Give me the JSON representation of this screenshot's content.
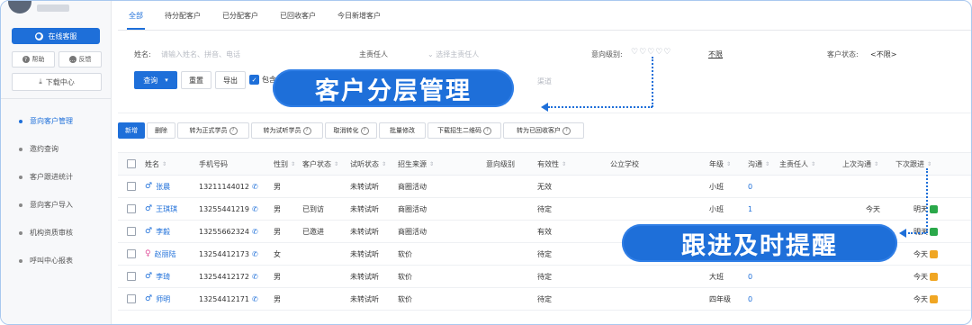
{
  "sidebar": {
    "online_service": "在线客服",
    "help": "帮助",
    "feedback": "反馈",
    "download_center": "下载中心",
    "menu": [
      {
        "label": "意向客户管理",
        "active": true
      },
      {
        "label": "邀约查询",
        "active": false
      },
      {
        "label": "客户跟进统计",
        "active": false
      },
      {
        "label": "意向客户导入",
        "active": false
      },
      {
        "label": "机构资质审核",
        "active": false
      },
      {
        "label": "呼叫中心报表",
        "active": false
      }
    ]
  },
  "tabs": [
    "全部",
    "待分配客户",
    "已分配客户",
    "已回收客户",
    "今日新增客户"
  ],
  "filters": {
    "name_label": "姓名:",
    "name_placeholder": "请输入姓名、拼音、电话",
    "owner_label": "主责任人",
    "owner_placeholder": "选择主责任人",
    "intent_label": "意向级别:",
    "intent_hearts": "♡♡♡♡♡",
    "unlimited": "不限",
    "status_label": "客户状态:",
    "status_value": "<不限>",
    "hidden_placeholder": "渠道"
  },
  "toolbar": {
    "query": "查询",
    "reset": "重置",
    "export": "导出",
    "include": "包含"
  },
  "callouts": {
    "top": "客户分层管理",
    "bottom": "跟进及时提醒"
  },
  "actions": [
    {
      "label": "新增",
      "primary": true,
      "help": false
    },
    {
      "label": "删除",
      "primary": false,
      "help": false
    },
    {
      "label": "转为正式学员",
      "primary": false,
      "help": true
    },
    {
      "label": "转为试听学员",
      "primary": false,
      "help": true
    },
    {
      "label": "取消转化",
      "primary": false,
      "help": true
    },
    {
      "label": "批量修改",
      "primary": false,
      "help": false
    },
    {
      "label": "下载招生二维码",
      "primary": false,
      "help": true
    },
    {
      "label": "转为已回收客户",
      "primary": false,
      "help": true
    }
  ],
  "table": {
    "headers": [
      "姓名",
      "手机号码",
      "性别",
      "客户状态",
      "试听状态",
      "招生来源",
      "意向级别",
      "有效性",
      "公立学校",
      "年级",
      "沟通",
      "主责任人",
      "上次沟通",
      "下次跟进"
    ],
    "rows": [
      {
        "name": "张晨",
        "gender_icon": "♂",
        "phone": "13211144012",
        "sex": "男",
        "status": "",
        "trial": "未转试听",
        "source": "商圈活动",
        "validity": "无效",
        "grade": "小班",
        "comm": "0",
        "last": "",
        "next": "",
        "bell": "none"
      },
      {
        "name": "王琪琪",
        "gender_icon": "♂",
        "phone": "13255441219",
        "sex": "男",
        "status": "已到访",
        "trial": "未转试听",
        "source": "商圈活动",
        "validity": "待定",
        "grade": "小班",
        "comm": "1",
        "last": "今天",
        "next": "明天",
        "bell": "green"
      },
      {
        "name": "李毅",
        "gender_icon": "♂",
        "phone": "13255662324",
        "sex": "男",
        "status": "已邀进",
        "trial": "未转试听",
        "source": "商圈活动",
        "validity": "有效",
        "grade": "",
        "comm": "",
        "last": "",
        "next": "明天",
        "bell": "green"
      },
      {
        "name": "赵丽陆",
        "gender_icon": "♀",
        "phone": "13254412173",
        "sex": "女",
        "status": "",
        "trial": "未转试听",
        "source": "软价",
        "validity": "待定",
        "grade": "",
        "comm": "",
        "last": "",
        "next": "今天",
        "bell": "orange"
      },
      {
        "name": "李琦",
        "gender_icon": "♂",
        "phone": "13254412172",
        "sex": "男",
        "status": "",
        "trial": "未转试听",
        "source": "软价",
        "validity": "待定",
        "grade": "大班",
        "comm": "0",
        "last": "",
        "next": "今天",
        "bell": "orange"
      },
      {
        "name": "师明",
        "gender_icon": "♂",
        "phone": "13254412171",
        "sex": "男",
        "status": "",
        "trial": "未转试听",
        "source": "软价",
        "validity": "待定",
        "grade": "四年级",
        "comm": "0",
        "last": "",
        "next": "今天",
        "bell": "orange"
      }
    ]
  }
}
